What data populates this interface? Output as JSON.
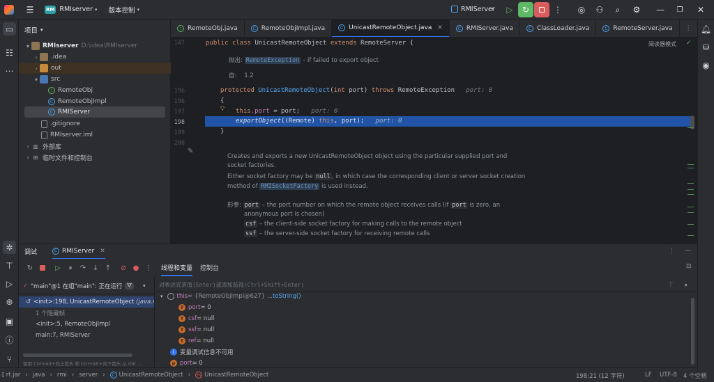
{
  "titlebar": {
    "project_badge": "RM",
    "project_name": "RMIserver",
    "vcs_label": "版本控制",
    "run_config": "RMIServer"
  },
  "project_panel": {
    "title": "项目",
    "items": [
      {
        "label": "RMIserver",
        "path": "D:\\idea\\RMIserver"
      },
      {
        "label": ".idea"
      },
      {
        "label": "out"
      },
      {
        "label": "src"
      },
      {
        "label": "RemoteObj"
      },
      {
        "label": "RemoteObjImpl"
      },
      {
        "label": "RMIServer"
      },
      {
        "label": ".gitignore"
      },
      {
        "label": "RMIserver.iml"
      },
      {
        "label": "外部库"
      },
      {
        "label": "临时文件和控制台"
      }
    ]
  },
  "editor_tabs": [
    {
      "label": "RemoteObj.java"
    },
    {
      "label": "RemoteObjImpl.java"
    },
    {
      "label": "UnicastRemoteObject.java"
    },
    {
      "label": "RMIServer.java"
    },
    {
      "label": "ClassLoader.java"
    },
    {
      "label": "RemoteServer.java"
    }
  ],
  "editor": {
    "reader_mode": "阅读器模式",
    "line_numbers": [
      "147",
      "196",
      "196",
      "197",
      "198",
      "199",
      "200"
    ],
    "lines": {
      "decl_kw1": "public",
      "decl_kw2": "class",
      "decl_name": " UnicastRemoteObject ",
      "decl_ext": "extends",
      "decl_super": " RemoteServer {",
      "ctor_kw": "protected",
      "ctor_name": "UnicastRemoteObject",
      "ctor_params_open": "(",
      "ctor_int": "int",
      "ctor_params_rest": " port) ",
      "ctor_throws": "throws",
      "ctor_exc": " RemoteException",
      "ctor_hint": "port: 0",
      "brace_open": "{",
      "assign_this": "this",
      "assign_field": ".port",
      "assign_rest": " = port;",
      "assign_hint": "port: 0",
      "export_fn": "exportObject",
      "export_open": "((Remote) ",
      "export_this": "this",
      "export_rest": ", port);",
      "export_hint": "port: 0",
      "brace_close": "}"
    },
    "doc_top": {
      "throws_label": "抛出:",
      "throws_tag": "RemoteException",
      "throws_text": " – if failed to export object",
      "since_label": "自:",
      "since_value": "1.2"
    },
    "doc_bottom": {
      "p1a": "Creates and exports a new UnicastRemoteObject object using the particular supplied port and",
      "p1b": "socket factories.",
      "p2a_pre": "Either socket factory may be ",
      "p2a_code": "null",
      "p2a_post": ", in which case the corresponding client or server socket creation",
      "p2b_pre": "method of ",
      "p2b_code": "RMISocketFactory",
      "p2b_post": " is used instead.",
      "params_label": "形参:",
      "param1_code": "port",
      "param1_text_a": " – the port number on which the remote object receives calls (if ",
      "param1_code2": "port",
      "param1_text_b": " is zero, an",
      "param1_text_c": "anonymous port is chosen)",
      "param2_code": "csf",
      "param2_text": " – the client-side socket factory for making calls to the remote object",
      "param3_code": "ssf",
      "param3_text": " – the server-side socket factory for receiving remote calls"
    }
  },
  "debug": {
    "title": "调试",
    "session": "RMIServer",
    "tab_threads": "线程和变量",
    "tab_console": "控制台",
    "thread_label": "\"main\"@1 在组\"main\": 正在运行",
    "eval_placeholder": "对表达式求值(Enter)或添加监视(Ctrl+Shift+Enter)",
    "frames": [
      {
        "label": "<init>:198, UnicastRemoteObject",
        "pkg": "(java.rmi.s"
      },
      {
        "label": "1 个隐藏帧"
      },
      {
        "label": "<init>:5, RemoteObjImpl"
      },
      {
        "label": "main:7, RMIServer"
      }
    ],
    "frames_hint": "使用 Ctrl+Alt+向上箭头 和 Ctrl+Alt+向下箭头 从 IDE ...",
    "vars": [
      {
        "name": "this",
        "value": " = {RemoteObjImpl@627} ... ",
        "link": "toString()"
      },
      {
        "name": "port",
        "value": " = 0"
      },
      {
        "name": "csf",
        "value": " = null"
      },
      {
        "name": "ssf",
        "value": " = null"
      },
      {
        "name": "ref",
        "value": " = null"
      },
      {
        "name": "变量调试信息不可用",
        "value": ""
      },
      {
        "name": "port",
        "value": " = 0"
      }
    ]
  },
  "statusbar": {
    "crumbs": [
      "rt.jar",
      "java",
      "rmi",
      "server",
      "UnicastRemoteObject",
      "UnicastRemoteObject"
    ],
    "position": "198:21 (12 字符)",
    "line_sep": "LF",
    "encoding": "UTF-8",
    "indent": "4 个空格"
  },
  "colors": {
    "accent": "#3574f0",
    "selection_line": "#2154a6",
    "stop_red": "#db5c5c",
    "run_green": "#5fb865"
  }
}
